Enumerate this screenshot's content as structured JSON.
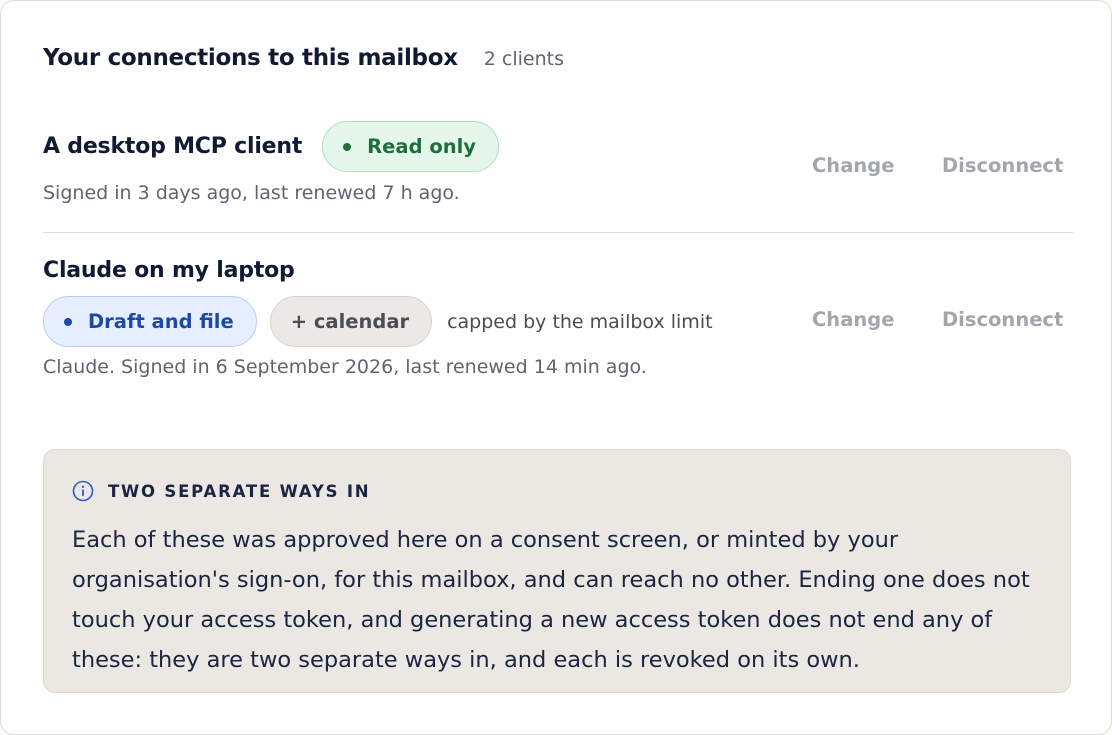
{
  "header": {
    "title": "Your connections to this mailbox",
    "count": "2 clients"
  },
  "connections": [
    {
      "name": "A desktop MCP client",
      "badge": "Read only",
      "badge_color": "#1d6e3b",
      "meta": "Signed in 3 days ago, last renewed 7 h ago.",
      "change_label": "Change",
      "disconnect_label": "Disconnect"
    },
    {
      "name": "Claude on my laptop",
      "badge": "Draft and file",
      "badge_color": "#1e48a6",
      "extra_badge": "+ calendar",
      "cap_note": "capped by the mailbox limit",
      "meta": "Claude. Signed in 6 September 2026, last renewed 14 min ago.",
      "change_label": "Change",
      "disconnect_label": "Disconnect"
    }
  ],
  "note": {
    "icon": "info-icon",
    "title": "TWO SEPARATE WAYS IN",
    "body": "Each of these was approved here on a consent screen, or minted by your organisation's sign-on, for this mailbox, and can reach no other. Ending one does not touch your access token, and generating a new access token does not end any of these: they are two separate ways in, and each is revoked on its own."
  },
  "colors": {
    "text_primary": "#111a33",
    "text_muted": "#5e6470",
    "action_disabled": "#a3a6ad",
    "note_bg": "#ebe8e4"
  }
}
